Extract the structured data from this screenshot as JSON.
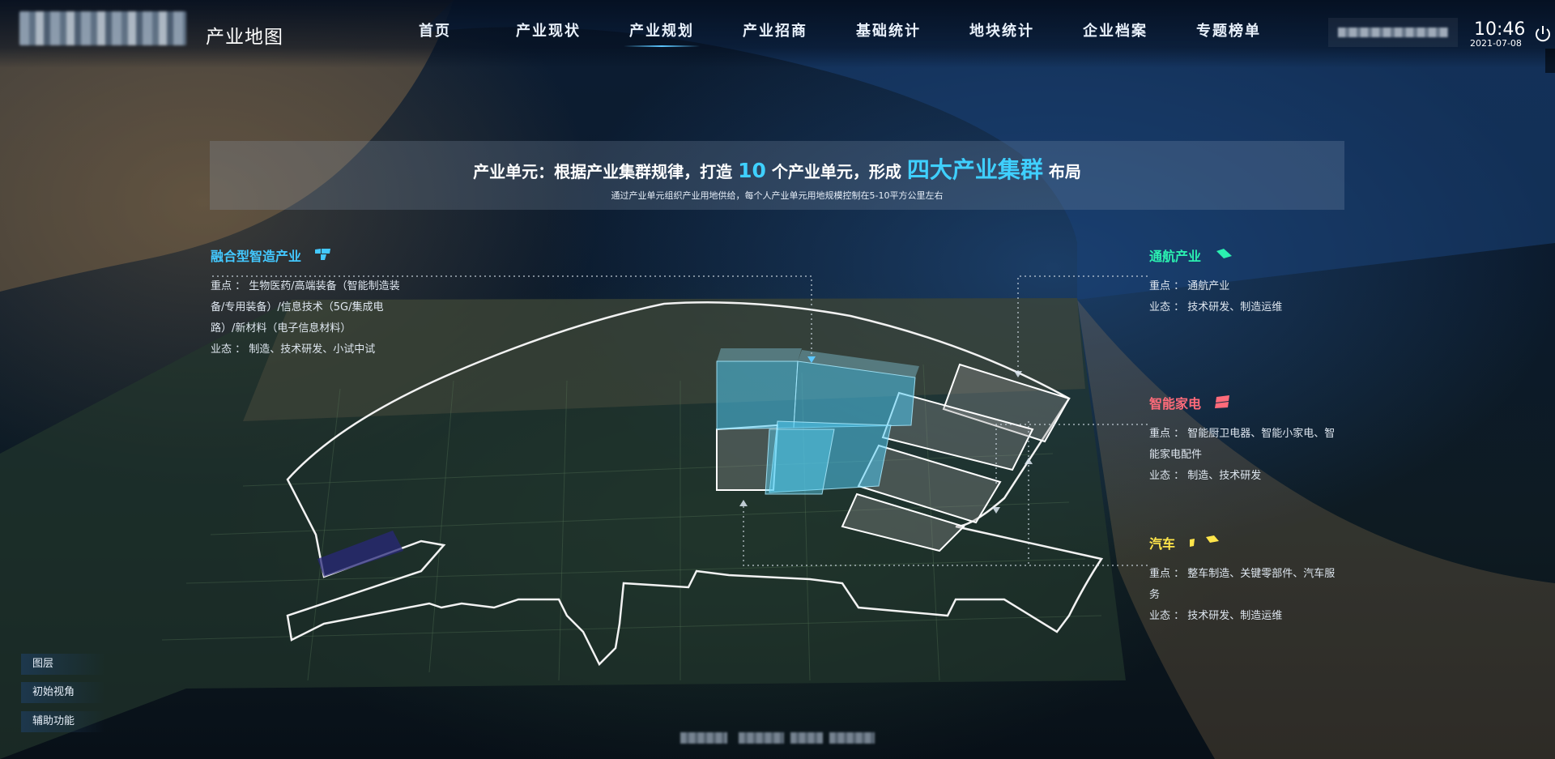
{
  "header": {
    "app_title": "产业地图",
    "nav": [
      {
        "label": "首页",
        "active": false
      },
      {
        "label": "产业现状",
        "active": false
      },
      {
        "label": "产业规划",
        "active": true
      },
      {
        "label": "产业招商",
        "active": false
      },
      {
        "label": "基础统计",
        "active": false
      },
      {
        "label": "地块统计",
        "active": false
      },
      {
        "label": "企业档案",
        "active": false
      },
      {
        "label": "专题榜单",
        "active": false
      }
    ],
    "time": "10:46",
    "date": "2021-07-08",
    "icons": {
      "power": "power-icon"
    }
  },
  "banner": {
    "prefix": "产业单元：根据产业集群规律，打造 ",
    "count": "10",
    "middle": " 个产业单元，形成 ",
    "highlight": "四大产业集群",
    "suffix": " 布局",
    "subtitle": "通过产业单元组织产业用地供给，每个人产业单元用地规模控制在5-10平方公里左右"
  },
  "clusters": {
    "smart_manufacturing": {
      "title": "融合型智造产业",
      "focus_label": "重点 ：",
      "focus": "生物医药/高端装备（智能制造装备/专用装备）/信息技术（5G/集成电路）/新材料（电子信息材料）",
      "format_label": "业态 ：",
      "format": "制造、技术研发、小试中试",
      "color": "#43c8ff",
      "icon": "building-blocks-icon"
    },
    "aviation": {
      "title": "通航产业",
      "focus_label": "重点 ：",
      "focus": "通航产业",
      "format_label": "业态 ：",
      "format": "技术研发、制造运维",
      "color": "#2bf0b0",
      "icon": "parcel-icon"
    },
    "appliance": {
      "title": "智能家电",
      "focus_label": "重点 ：",
      "focus": "智能厨卫电器、智能小家电、智能家电配件",
      "format_label": "业态 ：",
      "format": "制造、技术研发",
      "color": "#ff6b7a",
      "icon": "parcel-icon"
    },
    "auto": {
      "title": "汽车",
      "focus_label": "重点 ：",
      "focus": "整车制造、关键零部件、汽车服务",
      "format_label": "业态 ：",
      "format": "技术研发、制造运维",
      "color": "#ffe54a",
      "icon": "parcel-icon"
    }
  },
  "tools": [
    {
      "label": "图层"
    },
    {
      "label": "初始视角"
    },
    {
      "label": "辅助功能"
    }
  ]
}
